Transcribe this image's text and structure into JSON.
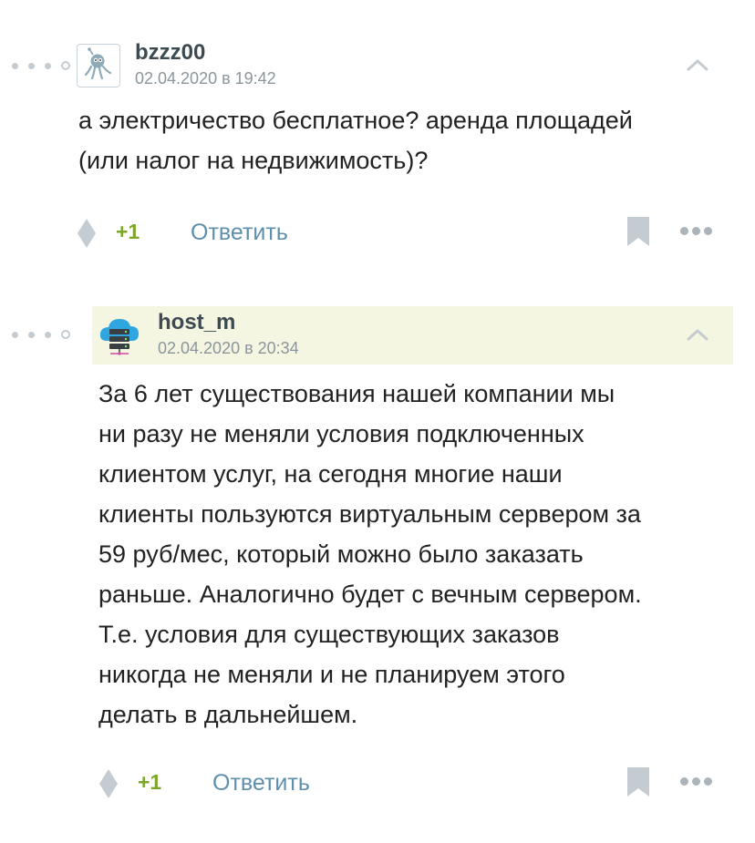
{
  "comments": [
    {
      "user": "bzzz00",
      "date": "02.04.2020 в 19:42",
      "avatar_icon": "robot-octopus-icon",
      "text_lines": [
        "а электричество бесплатное? аренда площадей",
        "(или налог на недвижимость)?"
      ],
      "score": "+1",
      "reply_label": "Ответить"
    },
    {
      "user": "host_m",
      "date": "02.04.2020 в 20:34",
      "avatar_icon": "cloud-server-icon",
      "text_lines": [
        "За 6 лет существования нашей компании мы",
        "ни разу не меняли условия подключенных",
        "клиентом услуг, на сегодня многие наши",
        "клиенты пользуются виртуальным сервером за",
        "59 руб/мес, который можно было заказать",
        "раньше. Аналогично будет с вечным сервером.",
        "Т.е. условия для существующих заказов",
        "никогда не меняли и не планируем этого",
        "делать в дальнейшем."
      ],
      "score": "+1",
      "reply_label": "Ответить"
    }
  ],
  "colors": {
    "score": "#7da62b",
    "reply": "#5e8fad",
    "highlight": "#f5f6e2",
    "icon": "#c5ccd1"
  }
}
